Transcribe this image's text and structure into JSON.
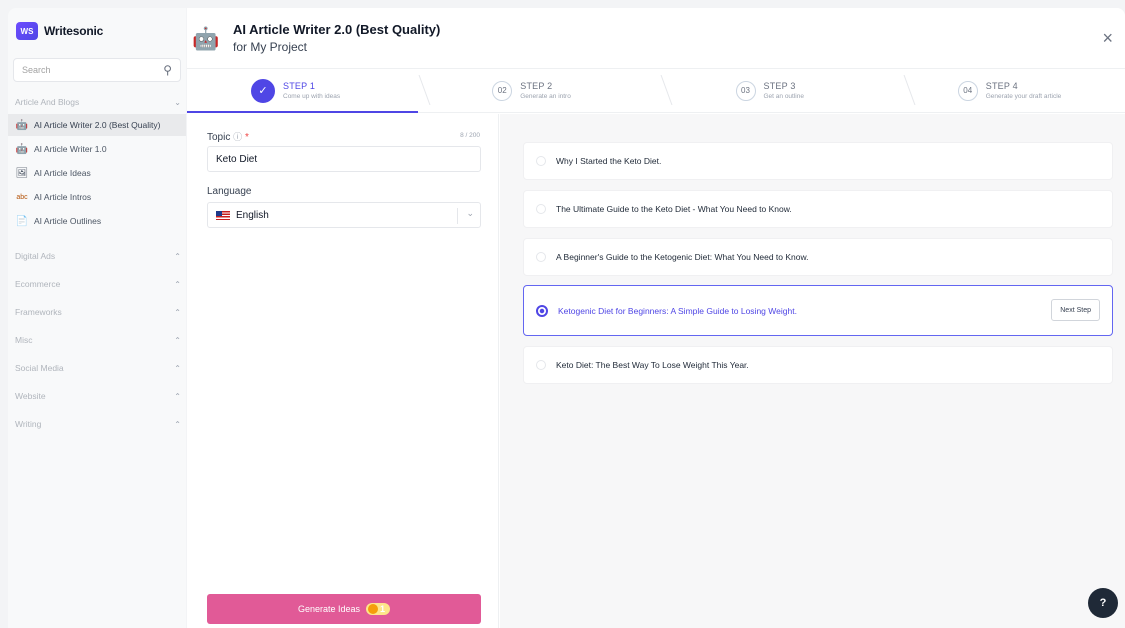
{
  "brand": {
    "logo_text": "WS",
    "name": "Writesonic"
  },
  "sidebar": {
    "search_placeholder": "Search",
    "category_open": "Article And Blogs",
    "items": [
      {
        "label": "AI Article Writer 2.0 (Best Quality)",
        "icon": "robot-icon",
        "active": true
      },
      {
        "label": "AI Article Writer 1.0",
        "icon": "robot-icon",
        "active": false
      },
      {
        "label": "AI Article Ideas",
        "icon": "image-icon",
        "active": false
      },
      {
        "label": "AI Article Intros",
        "icon": "abc-icon",
        "active": false
      },
      {
        "label": "AI Article Outlines",
        "icon": "document-icon",
        "active": false
      }
    ],
    "categories": [
      "Digital Ads",
      "Ecommerce",
      "Frameworks",
      "Misc",
      "Social Media",
      "Website",
      "Writing"
    ]
  },
  "header": {
    "title": "AI Article Writer 2.0 (Best Quality)",
    "subtitle": "for My Project",
    "close": "×"
  },
  "steps": [
    {
      "num": "✓",
      "label": "STEP 1",
      "desc": "Come up with ideas",
      "active": true
    },
    {
      "num": "02",
      "label": "STEP 2",
      "desc": "Generate an intro",
      "active": false
    },
    {
      "num": "03",
      "label": "STEP 3",
      "desc": "Get an outline",
      "active": false
    },
    {
      "num": "04",
      "label": "STEP 4",
      "desc": "Generate your draft article",
      "active": false
    }
  ],
  "form": {
    "topic_label": "Topic",
    "topic_count": "8 / 200",
    "topic_value": "Keto Diet",
    "language_label": "Language",
    "language_value": "English",
    "generate_label": "Generate Ideas",
    "credit": "1"
  },
  "ideas": [
    {
      "text": "Why I Started the Keto Diet.",
      "selected": false
    },
    {
      "text": "The Ultimate Guide to the Keto Diet - What You Need to Know.",
      "selected": false
    },
    {
      "text": "A Beginner's Guide to the Ketogenic Diet: What You Need to Know.",
      "selected": false
    },
    {
      "text": "Ketogenic Diet for Beginners: A Simple Guide to Losing Weight.",
      "selected": true
    },
    {
      "text": "Keto Diet: The Best Way To Lose Weight This Year.",
      "selected": false
    }
  ],
  "next_step_label": "Next Step",
  "help_label": "?",
  "colors": {
    "accent": "#4f46e5",
    "generate_button": "#e15a97"
  }
}
